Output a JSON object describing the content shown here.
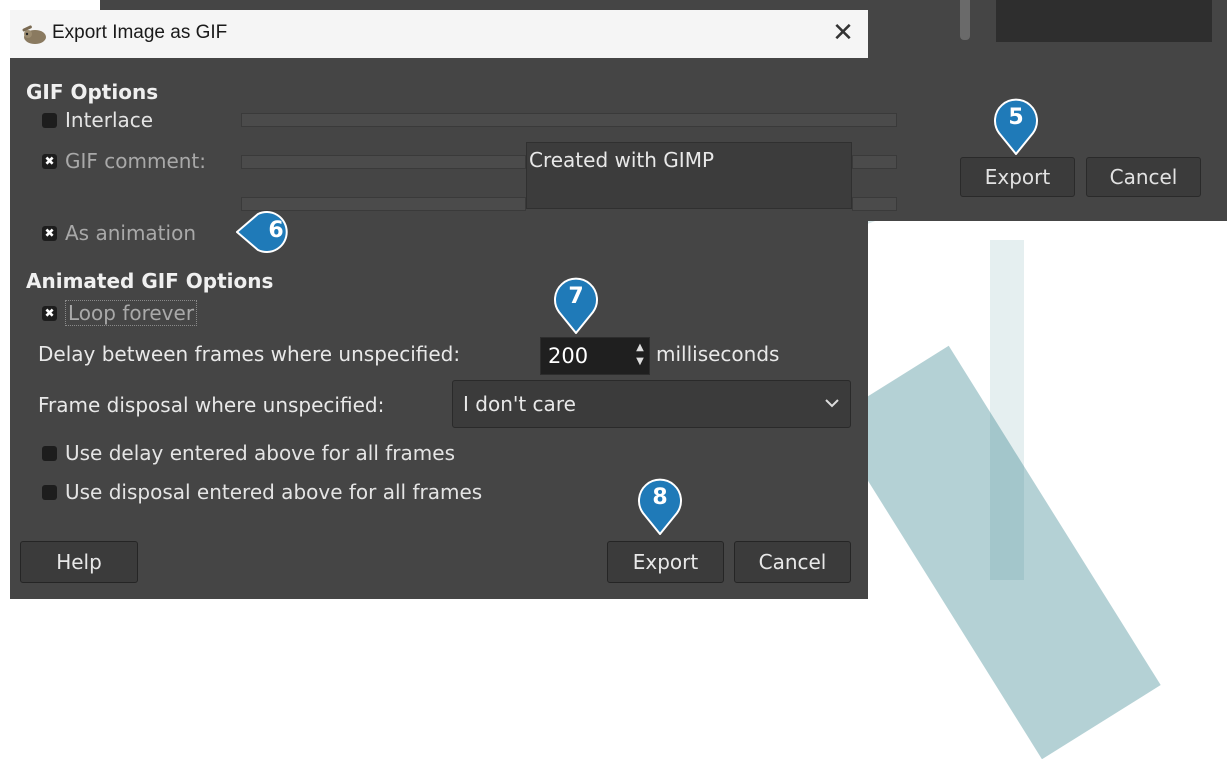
{
  "background_dialog": {
    "export_label": "Export",
    "cancel_label": "Cancel"
  },
  "dialog": {
    "title": "Export Image as GIF",
    "close_glyph": "✕",
    "gif_options": {
      "heading": "GIF Options",
      "interlace_label": "Interlace",
      "interlace_checked": false,
      "gif_comment_label": "GIF comment:",
      "gif_comment_checked": true,
      "gif_comment_value": "Created with GIMP",
      "as_animation_label": "As animation",
      "as_animation_checked": true
    },
    "animated_options": {
      "heading": "Animated GIF Options",
      "loop_forever_label": "Loop forever",
      "loop_forever_checked": true,
      "delay_label": "Delay between frames where unspecified:",
      "delay_value": "200",
      "delay_unit": "milliseconds",
      "disposal_label": "Frame disposal where unspecified:",
      "disposal_value": "I don't care",
      "use_delay_label": "Use delay entered above for all frames",
      "use_delay_checked": false,
      "use_disposal_label": "Use disposal entered above for all frames",
      "use_disposal_checked": false
    },
    "buttons": {
      "help_label": "Help",
      "export_label": "Export",
      "cancel_label": "Cancel"
    }
  },
  "callouts": [
    "5",
    "6",
    "7",
    "8"
  ],
  "check_glyph": "✖",
  "colors": {
    "dialog_bg": "#454545",
    "titlebar_bg": "#f5f5f5",
    "callout_fill": "#1f7ab8",
    "watermark": "#287c87"
  }
}
